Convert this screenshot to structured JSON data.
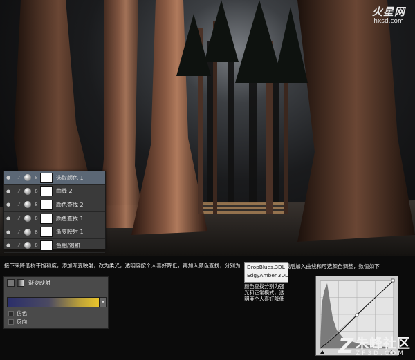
{
  "watermark_top": {
    "brand": "火星网",
    "url": "hxsd.com"
  },
  "layers_panel": {
    "items": [
      {
        "name": "选取颜色 1",
        "selected": true
      },
      {
        "name": "曲线 2",
        "selected": false
      },
      {
        "name": "颜色查找 2",
        "selected": false
      },
      {
        "name": "颜色查找 1",
        "selected": false
      },
      {
        "name": "渐变映射 1",
        "selected": false
      },
      {
        "name": "色相/饱和...",
        "selected": false
      }
    ]
  },
  "caption": {
    "left": "接下来降低树干饱和度，添加渐变映射，改为柔光，透明度按个人喜好降低，再加入颜色查找，分别为",
    "right": "最后加入曲线和可选颜色调整，数值如下"
  },
  "lut": {
    "items": [
      "DropBlues.3DL",
      "EdgyAmber.3DL"
    ],
    "note": "颜色查找分别为强光和正常模式，透明度个人喜好降低"
  },
  "gradient_map": {
    "title": "渐变映射",
    "options": [
      "仿色",
      "反向"
    ],
    "colors": {
      "start": "#2b2f6a",
      "end": "#e9c52c"
    }
  },
  "watermark_bottom": {
    "cn": "朱峰社区",
    "url": "ZF3D.COM"
  }
}
